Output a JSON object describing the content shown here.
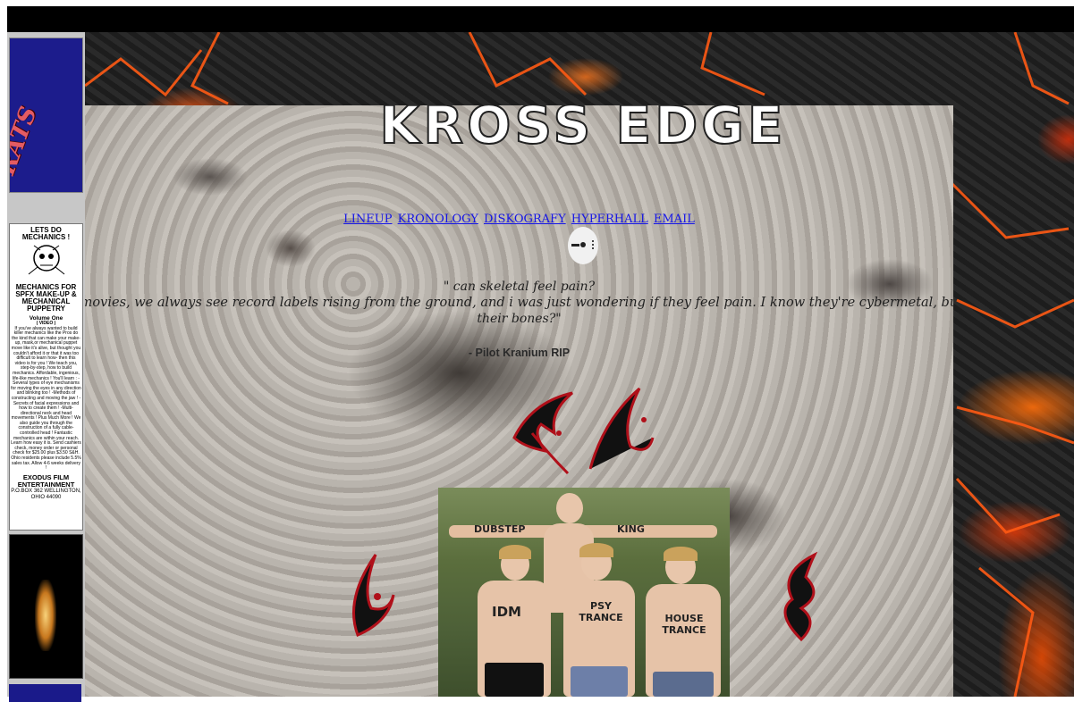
{
  "site": {
    "logo_text": "KROSS EDGE"
  },
  "nav": {
    "links": [
      "LINEUP",
      "KRONOLOGY",
      "DISKOGRAFY",
      "HYPERHALL",
      "EMAIL"
    ]
  },
  "quote": {
    "question": "\" can skeletal feel pain?",
    "body_line1": "In movies, we always see record labels rising from the ground, and i was just wondering if they feel pain. I know they're cybermetal, but do they still",
    "body_line2": "their bones?\"",
    "author": "- Pilot Kranium RIP"
  },
  "sidebar": {
    "banner_top": "RATS",
    "ad": {
      "headline": "LETS DO MECHANICS !",
      "title": "MECHANICS FOR SPFX MAKE-UP & MECHANICAL PUPPETRY",
      "volume": "Volume One",
      "format": "( VIDEO )",
      "body": "If you've always wanted to build killer mechanics like the Pros do the kind that can make your make-up, mask,or mechanical puppet move like it's alive, but thought you couldn't afford it or that it was too difficult to learn how- then this video is for you ! We teach you, step-by-step, how to build mechanics. Affordable, ingenious, life-like mechanics ! You'll learn : -Several types of eye mechanisms for moving the eyes in any direction and blinking too ! -Methods of constructing and moving the jaw ! -Secrets of facial expressions and how to create them ! -Multi-directional neck and head movements ! Plus Much More ! We also guide you through the construction of a fully cable-controlled head ! Fantastic mechanics are within your reach. Learn how easy it is. Send cashiers check, money order or personal check for $25.00 plus $3.50 S&H. Ohio residents please include 5.5% sales tax. Allow 4-6 weeks delivery !",
      "company": "EXODUS FILM ENTERTAINMENT",
      "address": "P.O.BOX 362 WELLINGTON, OHIO 44090"
    }
  },
  "photo": {
    "scrawls": [
      "DUBSTEP",
      "KING",
      "IDM",
      "PSY TRANCE",
      "HOUSE TRANCE"
    ]
  },
  "colors": {
    "nav_link": "#1414e6",
    "glyph_red": "#b0101a",
    "topbar": "#000000"
  }
}
